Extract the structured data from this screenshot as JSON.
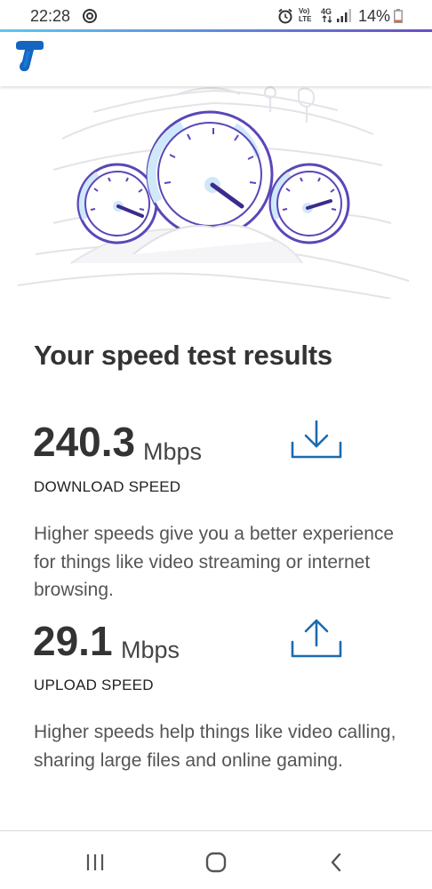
{
  "status_bar": {
    "time": "22:28",
    "battery": "14%",
    "network": "4G",
    "volte": "Vo) LTE"
  },
  "colors": {
    "brand": "#1565c0",
    "accent_blue": "#5bc8f5",
    "gauge_purple": "#6a4fc4",
    "icon_blue": "#1b6bb0"
  },
  "results": {
    "heading": "Your speed test results",
    "download": {
      "value": "240.3",
      "unit": "Mbps",
      "label": "DOWNLOAD SPEED",
      "description": "Higher speeds give you a better experience for things like video streaming or internet browsing.",
      "icon": "download-icon"
    },
    "upload": {
      "value": "29.1",
      "unit": "Mbps",
      "label": "UPLOAD SPEED",
      "description": "Higher speeds help things like video calling, sharing large files and online gaming.",
      "icon": "upload-icon"
    }
  },
  "nav": {
    "recents_icon": "recents-icon",
    "home_icon": "home-icon",
    "back_icon": "back-icon"
  }
}
